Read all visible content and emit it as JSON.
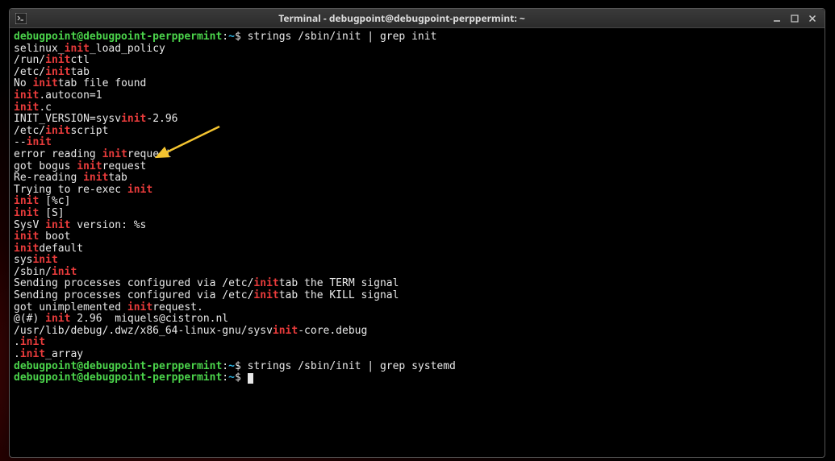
{
  "window": {
    "title": "Terminal - debugpoint@debugpoint-perppermint: ~"
  },
  "prompt": {
    "user_host": "debugpoint@debugpoint-perppermint",
    "sep": ":",
    "path": "~",
    "symbol": "$"
  },
  "commands": {
    "cmd1": "strings /sbin/init | grep init",
    "cmd2": "strings /sbin/init | grep systemd"
  },
  "output": {
    "l1a": "selinux_",
    "l1b": "init",
    "l1c": "_load_policy",
    "l2a": "/run/",
    "l2b": "init",
    "l2c": "ctl",
    "l3a": "/etc/",
    "l3b": "init",
    "l3c": "tab",
    "l4a": "No ",
    "l4b": "init",
    "l4c": "tab file found",
    "l5a": "init",
    "l5b": ".autocon=1",
    "l6a": "init",
    "l6b": ".c",
    "l7a": "INIT_VERSION=sysv",
    "l7b": "init",
    "l7c": "-2.96",
    "l8a": "/etc/",
    "l8b": "init",
    "l8c": "script",
    "l9a": "--",
    "l9b": "init",
    "l10a": "error reading ",
    "l10b": "init",
    "l10c": "request",
    "l11a": "got bogus ",
    "l11b": "init",
    "l11c": "request",
    "l12a": "Re-reading ",
    "l12b": "init",
    "l12c": "tab",
    "l13a": "Trying to re-exec ",
    "l13b": "init",
    "l14a": "init",
    "l14b": " [%c]",
    "l15a": "init",
    "l15b": " [S]",
    "l16a": "SysV ",
    "l16b": "init",
    "l16c": " version: %s",
    "l17a": "init",
    "l17b": " boot",
    "l18a": "init",
    "l18b": "default",
    "l19a": "sys",
    "l19b": "init",
    "l20a": "/sbin/",
    "l20b": "init",
    "l21a": "Sending processes configured via /etc/",
    "l21b": "init",
    "l21c": "tab the TERM signal",
    "l22a": "Sending processes configured via /etc/",
    "l22b": "init",
    "l22c": "tab the KILL signal",
    "l23a": "got unimplemented ",
    "l23b": "init",
    "l23c": "request.",
    "l24a": "@(#) ",
    "l24b": "init",
    "l24c": " 2.96  miquels@cistron.nl",
    "l25a": "/usr/lib/debug/.dwz/x86_64-linux-gnu/sysv",
    "l25b": "init",
    "l25c": "-core.debug",
    "l26a": ".",
    "l26b": "init",
    "l27a": ".",
    "l27b": "init",
    "l27c": "_array"
  },
  "arrow": {
    "color": "#f4c430"
  }
}
